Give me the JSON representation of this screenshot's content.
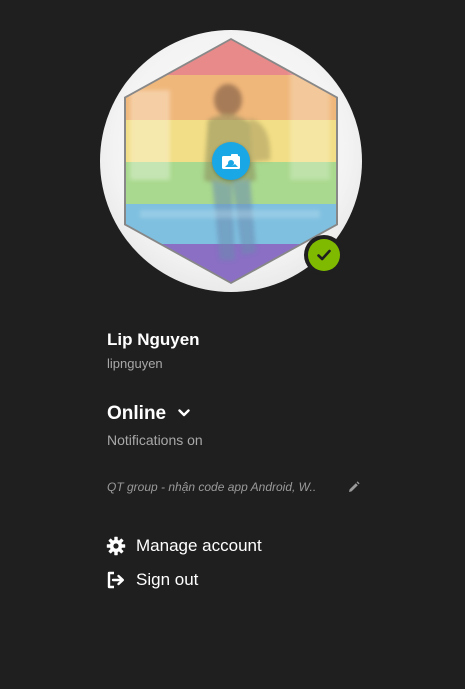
{
  "profile": {
    "display_name": "Lip Nguyen",
    "username": "lipnguyen",
    "avatar_alt": "profile picture"
  },
  "presence": {
    "status": "Online",
    "status_color": "#7fba00",
    "notifications": "Notifications on"
  },
  "mood": {
    "text": "QT group - nhận code app Android, W.."
  },
  "menu": {
    "manage_account": "Manage account",
    "sign_out": "Sign out"
  },
  "colors": {
    "background": "#1f1f1f",
    "accent": "#1aa7e6",
    "secondary_text": "#a8a8a8"
  },
  "icons": {
    "camera": "camera-icon",
    "check": "check-icon",
    "chevron": "chevron-down-icon",
    "edit": "pencil-icon",
    "gear": "gear-icon",
    "signout": "sign-out-icon"
  }
}
